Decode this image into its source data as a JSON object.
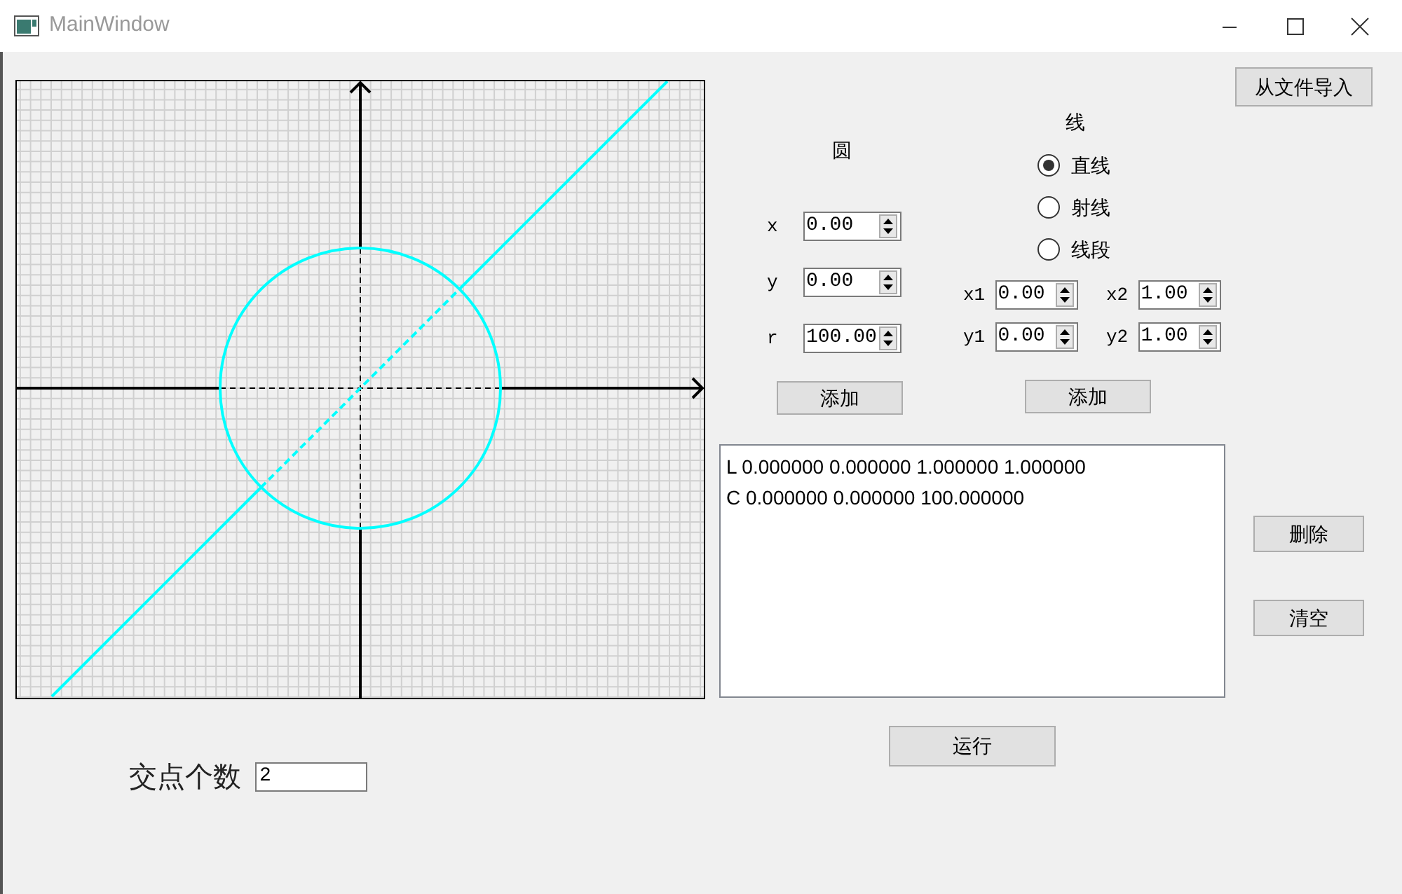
{
  "window": {
    "title": "MainWindow"
  },
  "import_button": "从文件导入",
  "circle": {
    "title": "圆",
    "fields": [
      {
        "label": "x",
        "value": "0.00"
      },
      {
        "label": "y",
        "value": "0.00"
      },
      {
        "label": "r",
        "value": "100.00"
      }
    ],
    "add_button": "添加"
  },
  "line": {
    "title": "线",
    "types": [
      {
        "label": "直线",
        "selected": true
      },
      {
        "label": "射线",
        "selected": false
      },
      {
        "label": "线段",
        "selected": false
      }
    ],
    "fields": [
      {
        "label": "x1",
        "value": "0.00"
      },
      {
        "label": "x2",
        "value": "1.00"
      },
      {
        "label": "y1",
        "value": "0.00"
      },
      {
        "label": "y2",
        "value": "1.00"
      }
    ],
    "add_button": "添加"
  },
  "shapes_list": [
    "L 0.000000 0.000000 1.000000 1.000000",
    "C 0.000000 0.000000 100.000000"
  ],
  "delete_button": "删除",
  "clear_button": "清空",
  "run_button": "运行",
  "intersection_count": {
    "label": "交点个数",
    "value": "2"
  }
}
